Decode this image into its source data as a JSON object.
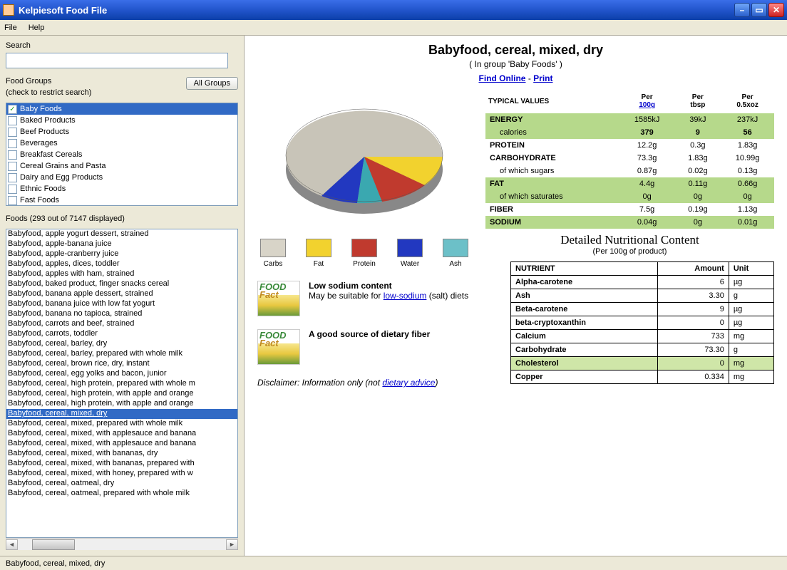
{
  "window": {
    "title": "Kelpiesoft Food File"
  },
  "menu": {
    "file": "File",
    "help": "Help"
  },
  "left": {
    "search_label": "Search",
    "groups_label": "Food Groups",
    "groups_hint": "(check to restrict search)",
    "all_groups_btn": "All Groups",
    "groups": [
      {
        "name": "Baby Foods",
        "checked": true,
        "selected": true
      },
      {
        "name": "Baked Products",
        "checked": false
      },
      {
        "name": "Beef Products",
        "checked": false
      },
      {
        "name": "Beverages",
        "checked": false
      },
      {
        "name": "Breakfast Cereals",
        "checked": false
      },
      {
        "name": "Cereal Grains and Pasta",
        "checked": false
      },
      {
        "name": "Dairy and Egg Products",
        "checked": false
      },
      {
        "name": "Ethnic Foods",
        "checked": false
      },
      {
        "name": "Fast Foods",
        "checked": false
      }
    ],
    "foods_label": "Foods (293 out of 7147 displayed)",
    "foods": [
      "Babyfood, apple yogurt dessert, strained",
      "Babyfood, apple-banana juice",
      "Babyfood, apple-cranberry juice",
      "Babyfood, apples, dices, toddler",
      "Babyfood, apples with ham, strained",
      "Babyfood, baked product, finger snacks cereal",
      "Babyfood, banana apple dessert, strained",
      "Babyfood, banana juice with low fat yogurt",
      "Babyfood, banana no tapioca, strained",
      "Babyfood, carrots and beef, strained",
      "Babyfood, carrots, toddler",
      "Babyfood, cereal, barley, dry",
      "Babyfood, cereal, barley, prepared with whole milk",
      "Babyfood, cereal, brown rice, dry, instant",
      "Babyfood, cereal, egg yolks and bacon, junior",
      "Babyfood, cereal, high protein, prepared with whole m",
      "Babyfood, cereal, high protein, with apple and orange",
      "Babyfood, cereal, high protein, with apple and orange",
      "Babyfood, cereal, mixed, dry",
      "Babyfood, cereal, mixed, prepared with whole milk",
      "Babyfood, cereal, mixed, with applesauce and banana",
      "Babyfood, cereal, mixed, with applesauce and banana",
      "Babyfood, cereal, mixed, with bananas, dry",
      "Babyfood, cereal, mixed, with bananas, prepared with",
      "Babyfood, cereal, mixed, with honey, prepared with w",
      "Babyfood, cereal, oatmeal, dry",
      "Babyfood, cereal, oatmeal, prepared with whole milk"
    ],
    "foods_selected_index": 18
  },
  "detail": {
    "title": "Babyfood, cereal, mixed, dry",
    "group_line": "( In group 'Baby Foods' )",
    "find_online": "Find Online",
    "sep": " - ",
    "print": "Print",
    "typical_header": "TYPICAL VALUES",
    "cols": {
      "c1a": "Per",
      "c1b": "100g",
      "c2a": "Per",
      "c2b": "tbsp",
      "c3a": "Per",
      "c3b": "0.5xoz"
    },
    "rows": {
      "energy": {
        "label": "ENERGY",
        "sub": "calories",
        "c1": "1585kJ",
        "c1s": "379",
        "c2": "39kJ",
        "c2s": "9",
        "c3": "237kJ",
        "c3s": "56"
      },
      "protein": {
        "label": "PROTEIN",
        "c1": "12.2g",
        "c2": "0.3g",
        "c3": "1.83g"
      },
      "carb": {
        "label": "CARBOHYDRATE",
        "sub": "of which sugars",
        "c1": "73.3g",
        "c1s": "0.87g",
        "c2": "1.83g",
        "c2s": "0.02g",
        "c3": "10.99g",
        "c3s": "0.13g"
      },
      "fat": {
        "label": "FAT",
        "sub": "of which saturates",
        "c1": "4.4g",
        "c1s": "0g",
        "c2": "0.11g",
        "c2s": "0g",
        "c3": "0.66g",
        "c3s": "0g"
      },
      "fiber": {
        "label": "FIBER",
        "c1": "7.5g",
        "c2": "0.19g",
        "c3": "1.13g"
      },
      "sodium": {
        "label": "SODIUM",
        "c1": "0.04g",
        "c2": "0g",
        "c3": "0.01g"
      }
    },
    "legend": {
      "carbs": "Carbs",
      "fat": "Fat",
      "protein": "Protein",
      "water": "Water",
      "ash": "Ash"
    },
    "fact1_head": "Low sodium content",
    "fact1_body_a": "May be suitable for ",
    "fact1_link": "low-sodium",
    "fact1_body_b": " (salt) diets",
    "fact2_head": "A good source of dietary fiber",
    "factimg_label": "FOOD",
    "factimg_label2": "Fact",
    "disclaimer_a": "Disclaimer: Information only (not ",
    "disclaimer_link": "dietary advice",
    "disclaimer_b": ")",
    "dnc_head": "Detailed Nutritional Content",
    "dnc_sub": "(Per 100g of product)",
    "dnc_cols": {
      "n": "NUTRIENT",
      "a": "Amount",
      "u": "Unit"
    },
    "dnc_rows": [
      {
        "n": "Alpha-carotene",
        "a": "6",
        "u": "µg"
      },
      {
        "n": "Ash",
        "a": "3.30",
        "u": "g"
      },
      {
        "n": "Beta-carotene",
        "a": "9",
        "u": "µg"
      },
      {
        "n": "beta-cryptoxanthin",
        "a": "0",
        "u": "µg"
      },
      {
        "n": "Calcium",
        "a": "733",
        "u": "mg"
      },
      {
        "n": "Carbohydrate",
        "a": "73.30",
        "u": "g"
      },
      {
        "n": "Cholesterol",
        "a": "0",
        "u": "mg",
        "hl": true
      },
      {
        "n": "Copper",
        "a": "0.334",
        "u": "mg"
      }
    ]
  },
  "status": {
    "text": "Babyfood, cereal, mixed, dry"
  },
  "chart_data": {
    "type": "pie",
    "title": "Macronutrient composition",
    "categories": [
      "Carbs",
      "Fat",
      "Protein",
      "Water",
      "Ash"
    ],
    "values": [
      73.3,
      4.4,
      12.2,
      6.8,
      3.3
    ],
    "colors": [
      "#d8d4c8",
      "#f2d22e",
      "#c03a2e",
      "#2238c0",
      "#3aa8b0"
    ]
  }
}
